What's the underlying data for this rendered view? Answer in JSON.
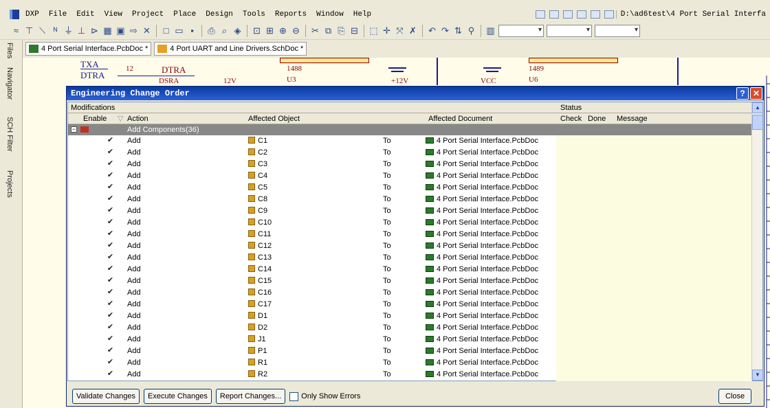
{
  "menubar": {
    "items": [
      "DXP",
      "File",
      "Edit",
      "View",
      "Project",
      "Place",
      "Design",
      "Tools",
      "Reports",
      "Window",
      "Help"
    ],
    "path": "D:\\ad6test\\4 Port Serial Interfa"
  },
  "side_tabs": [
    "Files",
    "Navigator",
    "SCH Filter",
    "Projects"
  ],
  "tabs": [
    {
      "label": "4 Port Serial Interface.PcbDoc *"
    },
    {
      "label": "4 Port UART and Line Drivers.SchDoc *"
    }
  ],
  "schematic": {
    "labels": [
      "TXA",
      "DTRA",
      "12",
      "DTRA",
      "1488",
      "U3",
      "+12V",
      "VCC",
      "1489",
      "U6",
      "DSRA",
      "12V"
    ]
  },
  "dialog": {
    "title": "Engineering Change Order",
    "columns": {
      "modifications": "Modifications",
      "enable": "Enable",
      "action": "Action",
      "affected_object": "Affected Object",
      "affected_document": "Affected Document",
      "status": "Status",
      "check": "Check",
      "done": "Done",
      "message": "Message"
    },
    "group": "Add Components(36)",
    "rows": [
      {
        "action": "Add",
        "object": "C1",
        "to": "To",
        "document": "4 Port Serial Interface.PcbDoc"
      },
      {
        "action": "Add",
        "object": "C2",
        "to": "To",
        "document": "4 Port Serial Interface.PcbDoc"
      },
      {
        "action": "Add",
        "object": "C3",
        "to": "To",
        "document": "4 Port Serial Interface.PcbDoc"
      },
      {
        "action": "Add",
        "object": "C4",
        "to": "To",
        "document": "4 Port Serial Interface.PcbDoc"
      },
      {
        "action": "Add",
        "object": "C5",
        "to": "To",
        "document": "4 Port Serial Interface.PcbDoc"
      },
      {
        "action": "Add",
        "object": "C8",
        "to": "To",
        "document": "4 Port Serial Interface.PcbDoc"
      },
      {
        "action": "Add",
        "object": "C9",
        "to": "To",
        "document": "4 Port Serial Interface.PcbDoc"
      },
      {
        "action": "Add",
        "object": "C10",
        "to": "To",
        "document": "4 Port Serial Interface.PcbDoc"
      },
      {
        "action": "Add",
        "object": "C11",
        "to": "To",
        "document": "4 Port Serial Interface.PcbDoc"
      },
      {
        "action": "Add",
        "object": "C12",
        "to": "To",
        "document": "4 Port Serial Interface.PcbDoc"
      },
      {
        "action": "Add",
        "object": "C13",
        "to": "To",
        "document": "4 Port Serial Interface.PcbDoc"
      },
      {
        "action": "Add",
        "object": "C14",
        "to": "To",
        "document": "4 Port Serial Interface.PcbDoc"
      },
      {
        "action": "Add",
        "object": "C15",
        "to": "To",
        "document": "4 Port Serial Interface.PcbDoc"
      },
      {
        "action": "Add",
        "object": "C16",
        "to": "To",
        "document": "4 Port Serial Interface.PcbDoc"
      },
      {
        "action": "Add",
        "object": "C17",
        "to": "To",
        "document": "4 Port Serial Interface.PcbDoc"
      },
      {
        "action": "Add",
        "object": "D1",
        "to": "To",
        "document": "4 Port Serial Interface.PcbDoc"
      },
      {
        "action": "Add",
        "object": "D2",
        "to": "To",
        "document": "4 Port Serial Interface.PcbDoc"
      },
      {
        "action": "Add",
        "object": "J1",
        "to": "To",
        "document": "4 Port Serial Interface.PcbDoc"
      },
      {
        "action": "Add",
        "object": "P1",
        "to": "To",
        "document": "4 Port Serial Interface.PcbDoc"
      },
      {
        "action": "Add",
        "object": "R1",
        "to": "To",
        "document": "4 Port Serial Interface.PcbDoc"
      },
      {
        "action": "Add",
        "object": "R2",
        "to": "To",
        "document": "4 Port Serial Interface.PcbDoc"
      }
    ],
    "buttons": {
      "validate": "Validate Changes",
      "execute": "Execute Changes",
      "report": "Report Changes...",
      "only_errors": "Only Show Errors",
      "close": "Close"
    }
  },
  "colors": {
    "title_bar": "#0a3aa0",
    "group_row": "#888888",
    "schematic_bg": "#fffcea"
  }
}
